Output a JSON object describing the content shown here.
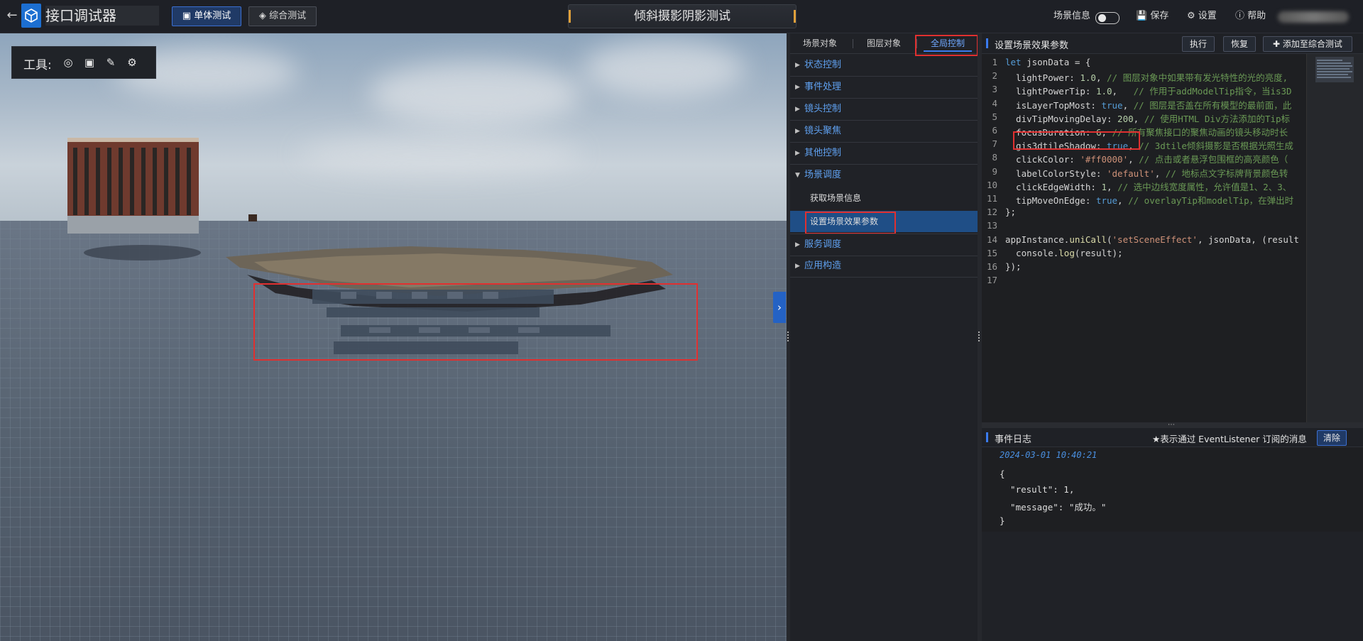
{
  "header": {
    "back_icon": "arrow-left-icon",
    "app_title": "接口调试器",
    "tabs": [
      {
        "label": "单体测试",
        "active": true
      },
      {
        "label": "综合测试",
        "active": false
      }
    ],
    "page_title": "倾斜摄影阴影测试",
    "scene_info_label": "场景信息",
    "save_label": "保存",
    "settings_label": "设置",
    "help_label": "帮助"
  },
  "viewport": {
    "tools_label": "工具:"
  },
  "menu": {
    "tabs": [
      "场景对象",
      "图层对象",
      "全局控制"
    ],
    "active_tab": "全局控制",
    "items": [
      {
        "label": "状态控制"
      },
      {
        "label": "事件处理"
      },
      {
        "label": "镜头控制"
      },
      {
        "label": "镜头聚焦"
      },
      {
        "label": "其他控制"
      },
      {
        "label": "场景调度"
      }
    ],
    "sub_items": [
      {
        "label": "获取场景信息"
      },
      {
        "label": "设置场景效果参数"
      }
    ],
    "items_after": [
      {
        "label": "服务调度"
      },
      {
        "label": "应用构造"
      }
    ]
  },
  "code_panel": {
    "title": "设置场景效果参数",
    "run_label": "执行",
    "restore_label": "恢复",
    "add_label": "添加至综合测试"
  },
  "code_lines": [
    "let jsonData = {",
    "  lightPower: 1.0, // 图层对象中如果带有发光特性的光的亮度,",
    "  lightPowerTip: 1.0,   // 作用于addModelTip指令，当is3D",
    "  isLayerTopMost: true, // 图层是否盖在所有模型的最前面，此",
    "  divTipMovingDelay: 200, // 使用HTML Div方法添加的Tip标",
    "  focusDuration: 6, // 所有聚焦接口的聚焦动画的镜头移动时长",
    "  gis3dtileShadow: true, // 3dtile倾斜摄影是否根据光照生成",
    "  clickColor: '#ff0000', // 点击或者悬浮包围框的高亮颜色（",
    "  labelColorStyle: 'default', // 地标点文字标牌背景颜色转",
    "  clickEdgeWidth: 1, // 选中边线宽度属性，允许值是1、2、3、",
    "  tipMoveOnEdge: true, // overlayTip和modelTip，在弹出时",
    "};",
    "",
    "appInstance.uniCall('setSceneEffect', jsonData, (result",
    "  console.log(result);",
    "});",
    ""
  ],
  "log_panel": {
    "title": "事件日志",
    "hint": "★表示通过 EventListener 订阅的消息",
    "clear_label": "清除",
    "timestamp": "2024-03-01 10:40:21",
    "lines": [
      "{",
      "  \"result\": 1,",
      "  \"message\": \"成功。\"",
      "}"
    ]
  },
  "colors": {
    "accent": "#3a7bef",
    "highlight": "#e03030",
    "menu_link": "#5fa0ef"
  }
}
